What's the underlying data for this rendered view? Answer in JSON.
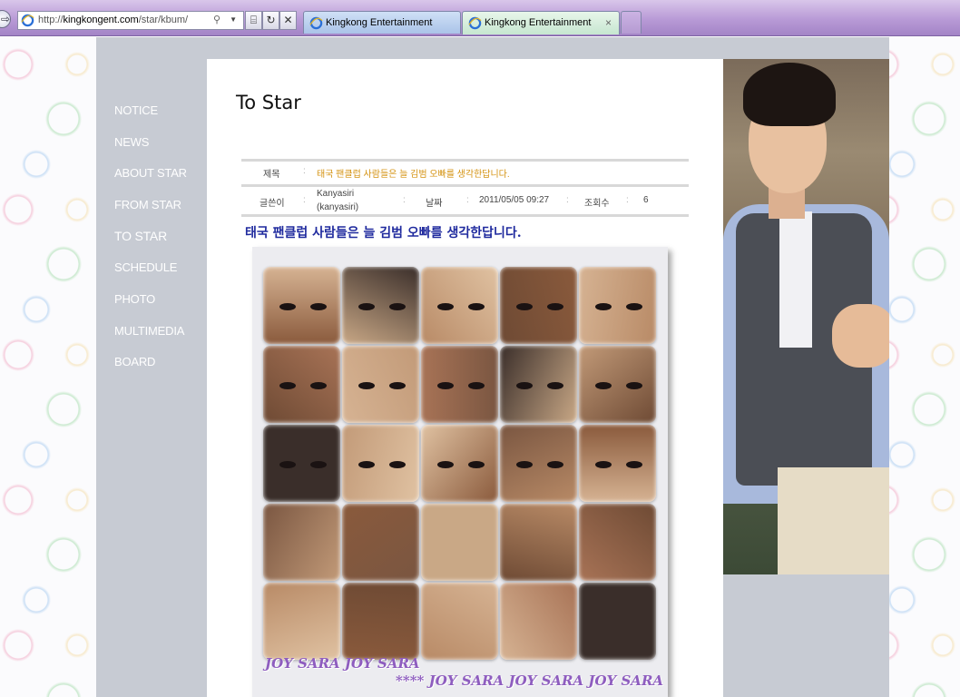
{
  "browser": {
    "url_prefix": "http://",
    "url_domain": "kingkongent.com",
    "url_path": "/star/kbum/",
    "tabs": [
      {
        "label": "Kingkong Entertainment"
      },
      {
        "label": "Kingkong Entertainment"
      }
    ],
    "close_glyph": "×",
    "stop_glyph": "✕",
    "refresh_glyph": "↻"
  },
  "nav": {
    "items": [
      "NOTICE",
      "NEWS",
      "ABOUT STAR",
      "FROM STAR",
      "TO STAR",
      "SCHEDULE",
      "PHOTO",
      "MULTIMEDIA",
      "BOARD"
    ]
  },
  "page": {
    "title": "To Star"
  },
  "post": {
    "subject_label": "제목",
    "subject": "태국 팬클럽 사람들은 늘 김범 오빠를 생각한답니다.",
    "author_label": "글쓴이",
    "author_name": "Kanyasiri",
    "author_id": "(kanyasiri)",
    "date_label": "날짜",
    "date": "2011/05/05 09:27",
    "views_label": "조회수",
    "views": "6",
    "heading": "태국 팬클럽 사람들은 늘 김범 오빠를 생각한답니다.",
    "watermark_1": "JOY SARA JOY SARA",
    "watermark_2": "**** JOY SARA JOY SARA JOY SARA"
  },
  "colors": {
    "chrome": "#b89ad6",
    "gray_frame": "#c7cbd3",
    "subject_text": "#d49210",
    "heading_text": "#1f2a9e",
    "watermark": "#8e5dbf"
  }
}
